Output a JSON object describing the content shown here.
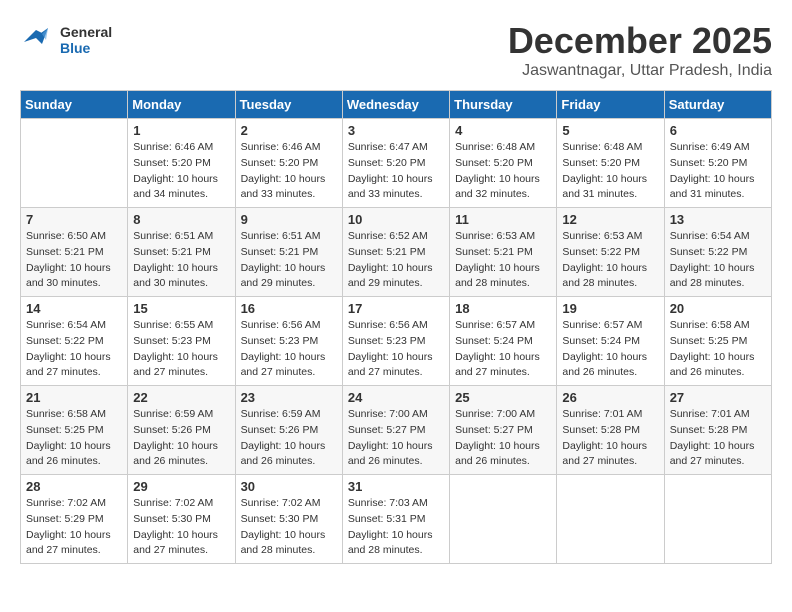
{
  "header": {
    "logo_general": "General",
    "logo_blue": "Blue",
    "month_title": "December 2025",
    "subtitle": "Jaswantnagar, Uttar Pradesh, India"
  },
  "days_of_week": [
    "Sunday",
    "Monday",
    "Tuesday",
    "Wednesday",
    "Thursday",
    "Friday",
    "Saturday"
  ],
  "weeks": [
    [
      {
        "day": "",
        "info": ""
      },
      {
        "day": "1",
        "info": "Sunrise: 6:46 AM\nSunset: 5:20 PM\nDaylight: 10 hours\nand 34 minutes."
      },
      {
        "day": "2",
        "info": "Sunrise: 6:46 AM\nSunset: 5:20 PM\nDaylight: 10 hours\nand 33 minutes."
      },
      {
        "day": "3",
        "info": "Sunrise: 6:47 AM\nSunset: 5:20 PM\nDaylight: 10 hours\nand 33 minutes."
      },
      {
        "day": "4",
        "info": "Sunrise: 6:48 AM\nSunset: 5:20 PM\nDaylight: 10 hours\nand 32 minutes."
      },
      {
        "day": "5",
        "info": "Sunrise: 6:48 AM\nSunset: 5:20 PM\nDaylight: 10 hours\nand 31 minutes."
      },
      {
        "day": "6",
        "info": "Sunrise: 6:49 AM\nSunset: 5:20 PM\nDaylight: 10 hours\nand 31 minutes."
      }
    ],
    [
      {
        "day": "7",
        "info": "Sunrise: 6:50 AM\nSunset: 5:21 PM\nDaylight: 10 hours\nand 30 minutes."
      },
      {
        "day": "8",
        "info": "Sunrise: 6:51 AM\nSunset: 5:21 PM\nDaylight: 10 hours\nand 30 minutes."
      },
      {
        "day": "9",
        "info": "Sunrise: 6:51 AM\nSunset: 5:21 PM\nDaylight: 10 hours\nand 29 minutes."
      },
      {
        "day": "10",
        "info": "Sunrise: 6:52 AM\nSunset: 5:21 PM\nDaylight: 10 hours\nand 29 minutes."
      },
      {
        "day": "11",
        "info": "Sunrise: 6:53 AM\nSunset: 5:21 PM\nDaylight: 10 hours\nand 28 minutes."
      },
      {
        "day": "12",
        "info": "Sunrise: 6:53 AM\nSunset: 5:22 PM\nDaylight: 10 hours\nand 28 minutes."
      },
      {
        "day": "13",
        "info": "Sunrise: 6:54 AM\nSunset: 5:22 PM\nDaylight: 10 hours\nand 28 minutes."
      }
    ],
    [
      {
        "day": "14",
        "info": "Sunrise: 6:54 AM\nSunset: 5:22 PM\nDaylight: 10 hours\nand 27 minutes."
      },
      {
        "day": "15",
        "info": "Sunrise: 6:55 AM\nSunset: 5:23 PM\nDaylight: 10 hours\nand 27 minutes."
      },
      {
        "day": "16",
        "info": "Sunrise: 6:56 AM\nSunset: 5:23 PM\nDaylight: 10 hours\nand 27 minutes."
      },
      {
        "day": "17",
        "info": "Sunrise: 6:56 AM\nSunset: 5:23 PM\nDaylight: 10 hours\nand 27 minutes."
      },
      {
        "day": "18",
        "info": "Sunrise: 6:57 AM\nSunset: 5:24 PM\nDaylight: 10 hours\nand 27 minutes."
      },
      {
        "day": "19",
        "info": "Sunrise: 6:57 AM\nSunset: 5:24 PM\nDaylight: 10 hours\nand 26 minutes."
      },
      {
        "day": "20",
        "info": "Sunrise: 6:58 AM\nSunset: 5:25 PM\nDaylight: 10 hours\nand 26 minutes."
      }
    ],
    [
      {
        "day": "21",
        "info": "Sunrise: 6:58 AM\nSunset: 5:25 PM\nDaylight: 10 hours\nand 26 minutes."
      },
      {
        "day": "22",
        "info": "Sunrise: 6:59 AM\nSunset: 5:26 PM\nDaylight: 10 hours\nand 26 minutes."
      },
      {
        "day": "23",
        "info": "Sunrise: 6:59 AM\nSunset: 5:26 PM\nDaylight: 10 hours\nand 26 minutes."
      },
      {
        "day": "24",
        "info": "Sunrise: 7:00 AM\nSunset: 5:27 PM\nDaylight: 10 hours\nand 26 minutes."
      },
      {
        "day": "25",
        "info": "Sunrise: 7:00 AM\nSunset: 5:27 PM\nDaylight: 10 hours\nand 26 minutes."
      },
      {
        "day": "26",
        "info": "Sunrise: 7:01 AM\nSunset: 5:28 PM\nDaylight: 10 hours\nand 27 minutes."
      },
      {
        "day": "27",
        "info": "Sunrise: 7:01 AM\nSunset: 5:28 PM\nDaylight: 10 hours\nand 27 minutes."
      }
    ],
    [
      {
        "day": "28",
        "info": "Sunrise: 7:02 AM\nSunset: 5:29 PM\nDaylight: 10 hours\nand 27 minutes."
      },
      {
        "day": "29",
        "info": "Sunrise: 7:02 AM\nSunset: 5:30 PM\nDaylight: 10 hours\nand 27 minutes."
      },
      {
        "day": "30",
        "info": "Sunrise: 7:02 AM\nSunset: 5:30 PM\nDaylight: 10 hours\nand 28 minutes."
      },
      {
        "day": "31",
        "info": "Sunrise: 7:03 AM\nSunset: 5:31 PM\nDaylight: 10 hours\nand 28 minutes."
      },
      {
        "day": "",
        "info": ""
      },
      {
        "day": "",
        "info": ""
      },
      {
        "day": "",
        "info": ""
      }
    ]
  ]
}
